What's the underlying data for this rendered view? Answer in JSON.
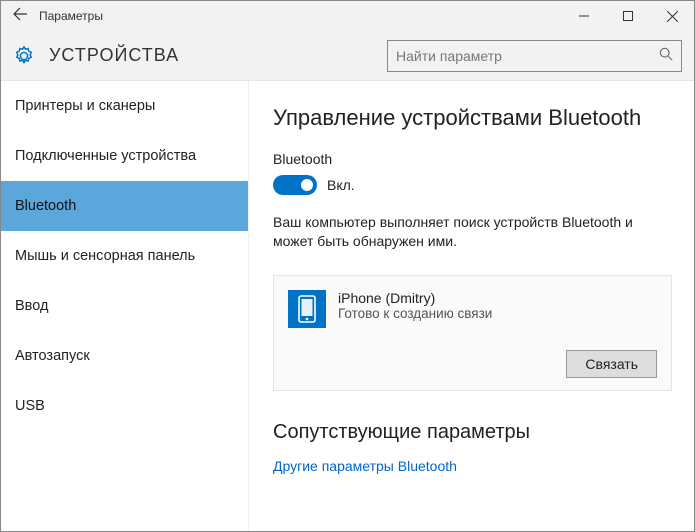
{
  "window": {
    "title": "Параметры"
  },
  "header": {
    "page_title": "УСТРОЙСТВА",
    "search_placeholder": "Найти параметр"
  },
  "sidebar": {
    "items": [
      {
        "label": "Принтеры и сканеры"
      },
      {
        "label": "Подключенные устройства"
      },
      {
        "label": "Bluetooth"
      },
      {
        "label": "Мышь и сенсорная панель"
      },
      {
        "label": "Ввод"
      },
      {
        "label": "Автозапуск"
      },
      {
        "label": "USB"
      }
    ],
    "active_index": 2
  },
  "main": {
    "heading": "Управление устройствами Bluetooth",
    "toggle_label": "Bluetooth",
    "toggle_state": "Вкл.",
    "description": "Ваш компьютер выполняет поиск устройств Bluetooth и может быть обнаружен ими.",
    "device": {
      "name": "iPhone (Dmitry)",
      "status": "Готово к созданию связи",
      "pair_button": "Связать"
    },
    "related_heading": "Сопутствующие параметры",
    "related_link": "Другие параметры Bluetooth"
  }
}
